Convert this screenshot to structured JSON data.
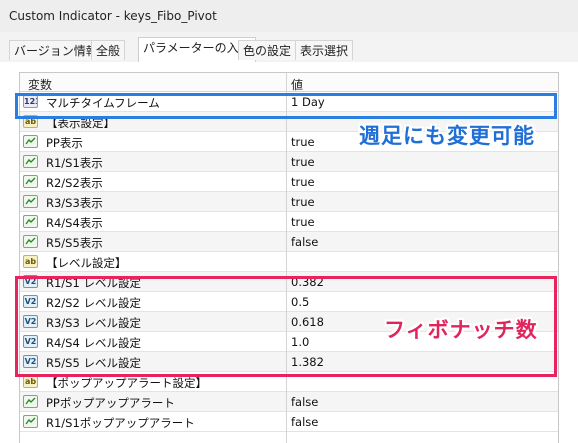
{
  "window": {
    "title": "Custom Indicator - keys_Fibo_Pivot"
  },
  "tabs": [
    {
      "label": "バージョン情報"
    },
    {
      "label": "全般"
    },
    {
      "label": "パラメーターの入力"
    },
    {
      "label": "色の設定"
    },
    {
      "label": "表示選択"
    }
  ],
  "table": {
    "header": {
      "name": "変数",
      "value": "値"
    },
    "rows": [
      {
        "type": "int",
        "icon_text": "123",
        "name": "マルチタイムフレーム",
        "value": "1 Day"
      },
      {
        "type": "str",
        "icon_text": "ab",
        "name": "【表示設定】",
        "value": ""
      },
      {
        "type": "bool",
        "icon_text": "",
        "name": "PP表示",
        "value": "true"
      },
      {
        "type": "bool",
        "icon_text": "",
        "name": "R1/S1表示",
        "value": "true"
      },
      {
        "type": "bool",
        "icon_text": "",
        "name": "R2/S2表示",
        "value": "true"
      },
      {
        "type": "bool",
        "icon_text": "",
        "name": "R3/S3表示",
        "value": "true"
      },
      {
        "type": "bool",
        "icon_text": "",
        "name": "R4/S4表示",
        "value": "true"
      },
      {
        "type": "bool",
        "icon_text": "",
        "name": "R5/S5表示",
        "value": "false"
      },
      {
        "type": "str",
        "icon_text": "ab",
        "name": "【レベル設定】",
        "value": ""
      },
      {
        "type": "dbl",
        "icon_text": "V2",
        "name": "R1/S1 レベル設定",
        "value": "0.382"
      },
      {
        "type": "dbl",
        "icon_text": "V2",
        "name": "R2/S2 レベル設定",
        "value": "0.5"
      },
      {
        "type": "dbl",
        "icon_text": "V2",
        "name": "R3/S3 レベル設定",
        "value": "0.618"
      },
      {
        "type": "dbl",
        "icon_text": "V2",
        "name": "R4/S4 レベル設定",
        "value": "1.0"
      },
      {
        "type": "dbl",
        "icon_text": "V2",
        "name": "R5/S5 レベル設定",
        "value": "1.382"
      },
      {
        "type": "str",
        "icon_text": "ab",
        "name": "【ポップアップアラート設定】",
        "value": ""
      },
      {
        "type": "bool",
        "icon_text": "",
        "name": "PPポップアップアラート",
        "value": "false"
      },
      {
        "type": "bool",
        "icon_text": "",
        "name": "R1/S1ポップアップアラート",
        "value": "false"
      }
    ]
  },
  "annotations": {
    "blue_text": "週足にも変更可能",
    "pink_text": "フィボナッチ数"
  },
  "colors": {
    "blue": "#2a7de1",
    "pink": "#e8245f"
  },
  "icons": {
    "int": "integer-param-icon",
    "str": "string-param-icon",
    "bool": "bool-param-icon",
    "dbl": "double-param-icon"
  }
}
